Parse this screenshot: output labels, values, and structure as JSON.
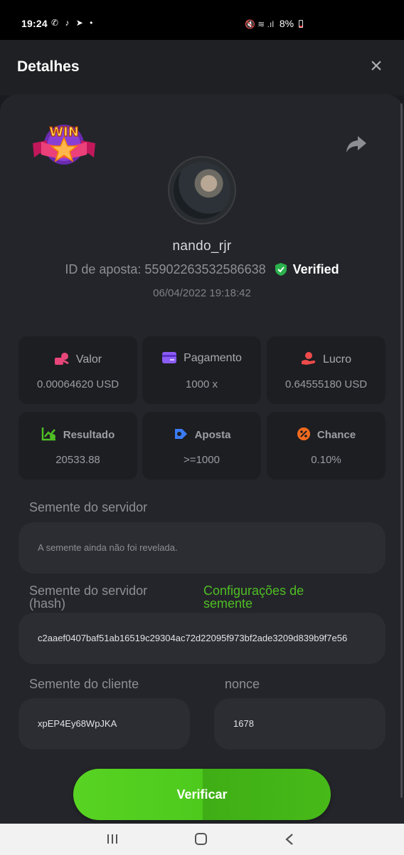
{
  "status_bar": {
    "time": "19:24",
    "app_icons": "✆ ♪ ➤ •",
    "signal_icons": "🔇 ≋ .ıl",
    "battery": "8%"
  },
  "header": {
    "title": "Detalhes",
    "close_icon": "close-icon"
  },
  "badge": {
    "text": "WIN"
  },
  "player": {
    "username": "nando_rjr",
    "bet_id_label": "ID de aposta:",
    "bet_id": "55902263532586638",
    "verified_label": "Verified",
    "date": "06/04/2022 19:18:42"
  },
  "stats": [
    {
      "label": "Valor",
      "value": "0.00064620 USD",
      "icon": "bet-amount-icon",
      "color": "#e8467a"
    },
    {
      "label": "Pagamento",
      "value": "1000 x",
      "icon": "payout-card-icon",
      "color": "#8b5cf6"
    },
    {
      "label": "Lucro",
      "value": "0.64555180 USD",
      "icon": "profit-hand-icon",
      "color": "#ef4a4a"
    },
    {
      "label": "Resultado",
      "value": "20533.88",
      "icon": "result-chart-icon",
      "color": "#4fbe24"
    },
    {
      "label": "Aposta",
      "value": ">=1000",
      "icon": "target-tag-icon",
      "color": "#3b7cf5"
    },
    {
      "label": "Chance",
      "value": "0.10%",
      "icon": "percent-icon",
      "color": "#f26b1d"
    }
  ],
  "server_seed": {
    "label": "Semente do servidor",
    "value": "A semente ainda não foi revelada."
  },
  "server_seed_hash": {
    "label_line1": "Semente do servidor",
    "label_line2": "(hash)",
    "settings_link_line1": "Configurações de",
    "settings_link_line2": "semente",
    "value": "c2aaef0407baf51ab16519c29304ac72d22095f973bf2ade3209d839b9f7e56"
  },
  "client_seed": {
    "label": "Semente do cliente",
    "value": "xpEP4Ey68WpJKA"
  },
  "nonce": {
    "label": "nonce",
    "value": "1678"
  },
  "verify_button": {
    "label": "Verificar"
  },
  "colors": {
    "accent_green": "#4fbe24",
    "background": "#1a1b1e",
    "sheet": "#24252a",
    "card": "#1d1e22",
    "field": "#2c2d32"
  }
}
